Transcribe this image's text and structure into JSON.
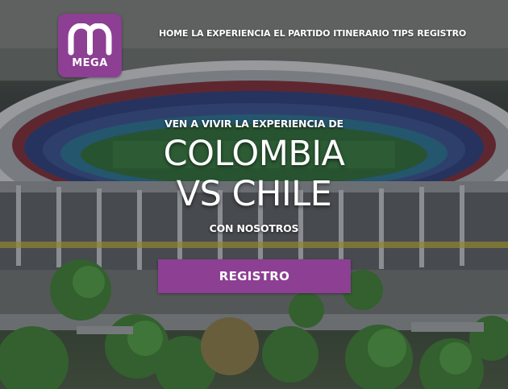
{
  "brand": {
    "logo_text": "MEGA",
    "color": "#8c3f93"
  },
  "nav": {
    "items": [
      {
        "label": "HOME"
      },
      {
        "label": "LA EXPERIENCIA"
      },
      {
        "label": "EL PARTIDO"
      },
      {
        "label": "ITINERARIO"
      },
      {
        "label": "TIPS"
      },
      {
        "label": "REGISTRO"
      }
    ]
  },
  "hero": {
    "pre_title": "VEN A VIVIR LA EXPERIENCIA DE",
    "headline_line1": "COLOMBIA",
    "headline_line2": "VS CHILE",
    "post_title": "CON NOSOTROS",
    "cta_label": "REGISTRO",
    "background_image": "aerial view of a football stadium"
  }
}
